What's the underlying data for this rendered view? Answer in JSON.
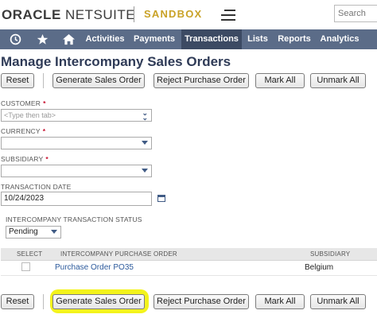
{
  "brand": {
    "oracle": "ORACLE",
    "netsuite": "NETSUITE",
    "environment": "SANDBOX"
  },
  "search": {
    "placeholder": "Search"
  },
  "nav": {
    "icons": [
      "history-icon",
      "star-icon",
      "home-icon"
    ],
    "items": [
      {
        "label": "Activities",
        "active": false
      },
      {
        "label": "Payments",
        "active": false
      },
      {
        "label": "Transactions",
        "active": true
      },
      {
        "label": "Lists",
        "active": false
      },
      {
        "label": "Reports",
        "active": false
      },
      {
        "label": "Analytics",
        "active": false
      }
    ]
  },
  "page": {
    "title": "Manage Intercompany Sales Orders"
  },
  "buttons": {
    "reset": "Reset",
    "generate": "Generate Sales Order",
    "reject": "Reject Purchase Order",
    "mark_all": "Mark All",
    "unmark_all": "Unmark All"
  },
  "form": {
    "customer": {
      "label": "CUSTOMER",
      "required": "*",
      "placeholder": "<Type then tab>"
    },
    "currency": {
      "label": "CURRENCY",
      "required": "*",
      "value": ""
    },
    "subsidiary": {
      "label": "SUBSIDIARY",
      "required": "*",
      "value": ""
    },
    "transaction_date": {
      "label": "TRANSACTION DATE",
      "value": "10/24/2023"
    },
    "ic_status": {
      "label": "INTERCOMPANY TRANSACTION STATUS",
      "value": "Pending"
    }
  },
  "table": {
    "headers": {
      "select": "SELECT",
      "purchase_order": "INTERCOMPANY PURCHASE ORDER",
      "subsidiary": "SUBSIDIARY"
    },
    "rows": [
      {
        "selected": false,
        "purchase_order": "Purchase Order PO35",
        "subsidiary": "Belgium"
      }
    ]
  },
  "colors": {
    "nav_background": "#5b6c88",
    "nav_active": "#3c4a63",
    "title": "#2f3b57",
    "sandbox": "#c9a227",
    "highlight": "#f3f31c",
    "link": "#2c5a9c"
  }
}
